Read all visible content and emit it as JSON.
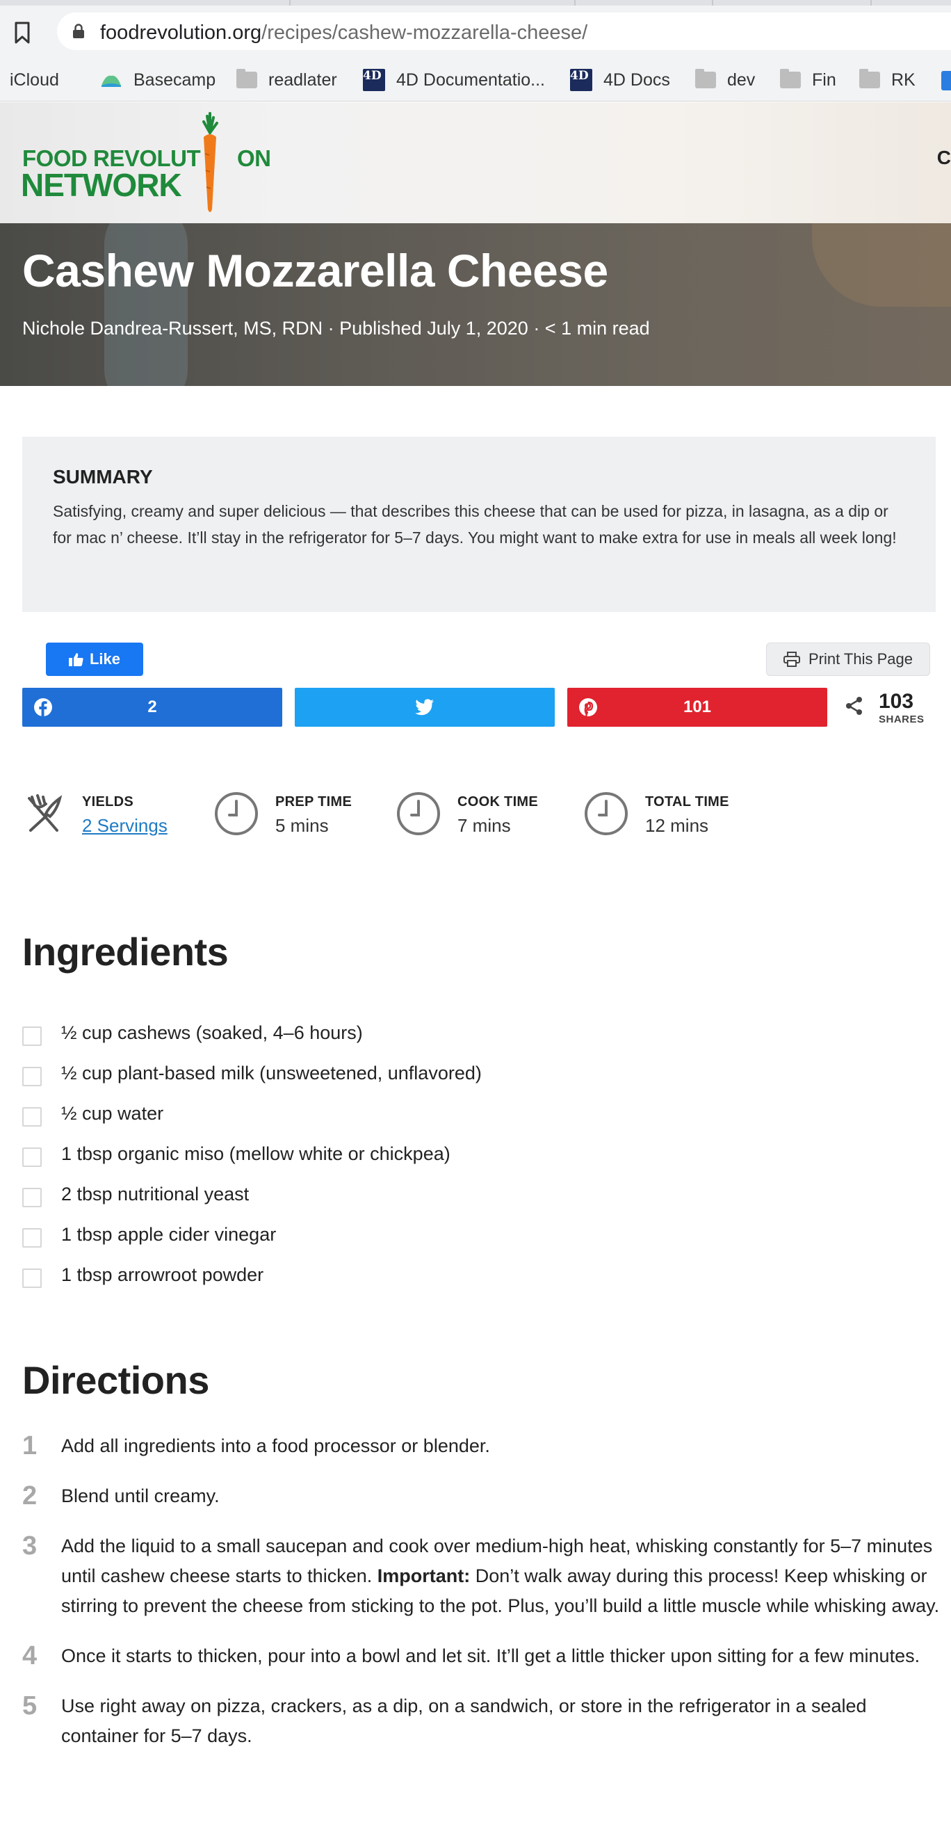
{
  "browser": {
    "url_host": "foodrevolution.org",
    "url_path": "/recipes/cashew-mozzarella-cheese/",
    "bookmarks": [
      {
        "label": "iCloud",
        "icon": "apple-icon"
      },
      {
        "label": "Basecamp",
        "icon": "basecamp-icon"
      },
      {
        "label": "readlater",
        "icon": "folder-icon"
      },
      {
        "label": "4D Documentatio...",
        "icon": "4d-icon"
      },
      {
        "label": "4D Docs",
        "icon": "4d-icon"
      },
      {
        "label": "dev",
        "icon": "folder-icon"
      },
      {
        "label": "Fin",
        "icon": "folder-icon"
      },
      {
        "label": "RK",
        "icon": "folder-icon"
      }
    ]
  },
  "site": {
    "logo_line1a": "FOOD REVOLUT",
    "logo_line1b": "ON",
    "logo_line2": "NETWORK",
    "menu_peek": "C"
  },
  "hero": {
    "title": "Cashew Mozzarella Cheese",
    "byline": "Nichole Dandrea-Russert, MS, RDN · Published July 1, 2020 · < 1 min read"
  },
  "summary": {
    "heading": "SUMMARY",
    "text": "Satisfying, creamy and super delicious — that describes this cheese that can be used for pizza, in lasagna, as a dip or for mac n’ cheese. It’ll stay in the refrigerator for 5–7 days. You might want to make extra for use in meals all week long!"
  },
  "social": {
    "like_label": "Like",
    "print_label": "Print This Page",
    "facebook_count": "2",
    "pinterest_count": "101",
    "total_shares": "103",
    "shares_label": "SHARES"
  },
  "meta": {
    "yields_label": "YIELDS",
    "yields_value": "2 Servings",
    "prep_label": "PREP TIME",
    "prep_value": "5 mins",
    "cook_label": "COOK TIME",
    "cook_value": "7 mins",
    "total_label": "TOTAL TIME",
    "total_value": "12 mins"
  },
  "ingredients": {
    "title": "Ingredients",
    "items": [
      "½ cup cashews (soaked, 4–6 hours)",
      "½ cup plant-based milk (unsweetened, unflavored)",
      "½ cup water",
      "1 tbsp organic miso (mellow white or chickpea)",
      "2 tbsp nutritional yeast",
      "1 tbsp apple cider vinegar",
      "1 tbsp arrowroot powder"
    ]
  },
  "directions": {
    "title": "Directions",
    "steps": [
      {
        "num": "1",
        "text": "Add all ingredients into a food processor or blender."
      },
      {
        "num": "2",
        "text": "Blend until creamy."
      },
      {
        "num": "3",
        "text_before": "Add the liquid to a small saucepan and cook over medium-high heat, whisking constantly for 5–7 minutes until cashew cheese starts to thicken. ",
        "bold": "Important:",
        "text_after": " Don’t walk away during this process! Keep whisking or stirring to prevent the cheese from sticking to the pot. Plus, you’ll build a little muscle while whisking away."
      },
      {
        "num": "4",
        "text": "Once it starts to thicken, pour into a bowl and let sit. It’ll get a little thicker upon sitting for a few minutes."
      },
      {
        "num": "5",
        "text": "Use right away on pizza, crackers, as a dip, on a sandwich, or store in the refrigerator in a sealed container for 5–7 days."
      }
    ]
  },
  "colors": {
    "brand_green": "#1f8a3b",
    "carrot_orange": "#f07a1a",
    "facebook": "#1f6fd6",
    "twitter": "#1da1f2",
    "pinterest": "#e0232e",
    "link": "#1f7bc4"
  }
}
